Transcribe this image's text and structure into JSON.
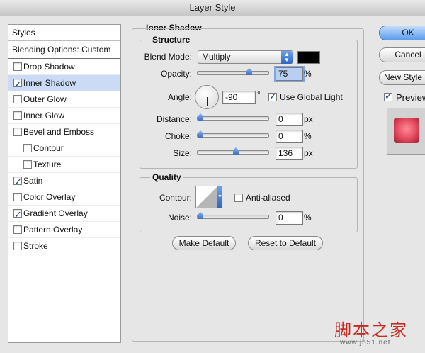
{
  "window": {
    "title": "Layer Style"
  },
  "styles_panel": {
    "header": "Styles",
    "blending_options": "Blending Options: Custom",
    "items": [
      {
        "label": "Drop Shadow",
        "checked": false,
        "selected": false,
        "sub": false
      },
      {
        "label": "Inner Shadow",
        "checked": true,
        "selected": true,
        "sub": false
      },
      {
        "label": "Outer Glow",
        "checked": false,
        "selected": false,
        "sub": false
      },
      {
        "label": "Inner Glow",
        "checked": false,
        "selected": false,
        "sub": false
      },
      {
        "label": "Bevel and Emboss",
        "checked": false,
        "selected": false,
        "sub": false
      },
      {
        "label": "Contour",
        "checked": false,
        "selected": false,
        "sub": true
      },
      {
        "label": "Texture",
        "checked": false,
        "selected": false,
        "sub": true
      },
      {
        "label": "Satin",
        "checked": true,
        "selected": false,
        "sub": false
      },
      {
        "label": "Color Overlay",
        "checked": false,
        "selected": false,
        "sub": false
      },
      {
        "label": "Gradient Overlay",
        "checked": true,
        "selected": false,
        "sub": false
      },
      {
        "label": "Pattern Overlay",
        "checked": false,
        "selected": false,
        "sub": false
      },
      {
        "label": "Stroke",
        "checked": false,
        "selected": false,
        "sub": false
      }
    ]
  },
  "inner_shadow": {
    "title": "Inner Shadow",
    "structure": {
      "title": "Structure",
      "blend_mode_label": "Blend Mode:",
      "blend_mode_value": "Multiply",
      "shadow_color": "#000000",
      "opacity_label": "Opacity:",
      "opacity_value": "75",
      "opacity_unit": "%",
      "opacity_fraction": 0.75,
      "angle_label": "Angle:",
      "angle_value": "-90",
      "angle_unit": "°",
      "use_global_light_label": "Use Global Light",
      "use_global_light_checked": true,
      "distance_label": "Distance:",
      "distance_value": "0",
      "distance_unit": "px",
      "distance_fraction": 0,
      "choke_label": "Choke:",
      "choke_value": "0",
      "choke_unit": "%",
      "choke_fraction": 0,
      "size_label": "Size:",
      "size_value": "136",
      "size_unit": "px",
      "size_fraction": 0.54
    },
    "quality": {
      "title": "Quality",
      "contour_label": "Contour:",
      "anti_aliased_label": "Anti-aliased",
      "anti_aliased_checked": false,
      "noise_label": "Noise:",
      "noise_value": "0",
      "noise_unit": "%",
      "noise_fraction": 0
    },
    "make_default_label": "Make Default",
    "reset_default_label": "Reset to Default"
  },
  "right_panel": {
    "ok_label": "OK",
    "cancel_label": "Cancel",
    "new_style_label": "New Style",
    "preview_label": "Preview",
    "preview_checked": true
  },
  "watermark": {
    "text": "脚本之家",
    "url": "www.jb51.net"
  },
  "colors": {
    "selected_row": "#cbdbf5",
    "accent": "#5d9cf0",
    "preview_fill": "#e2475c"
  },
  "icons": [
    "checkmark-icon",
    "select-arrows-icon",
    "angle-dial-icon",
    "slider-thumb-icon",
    "contour-curve-icon"
  ]
}
